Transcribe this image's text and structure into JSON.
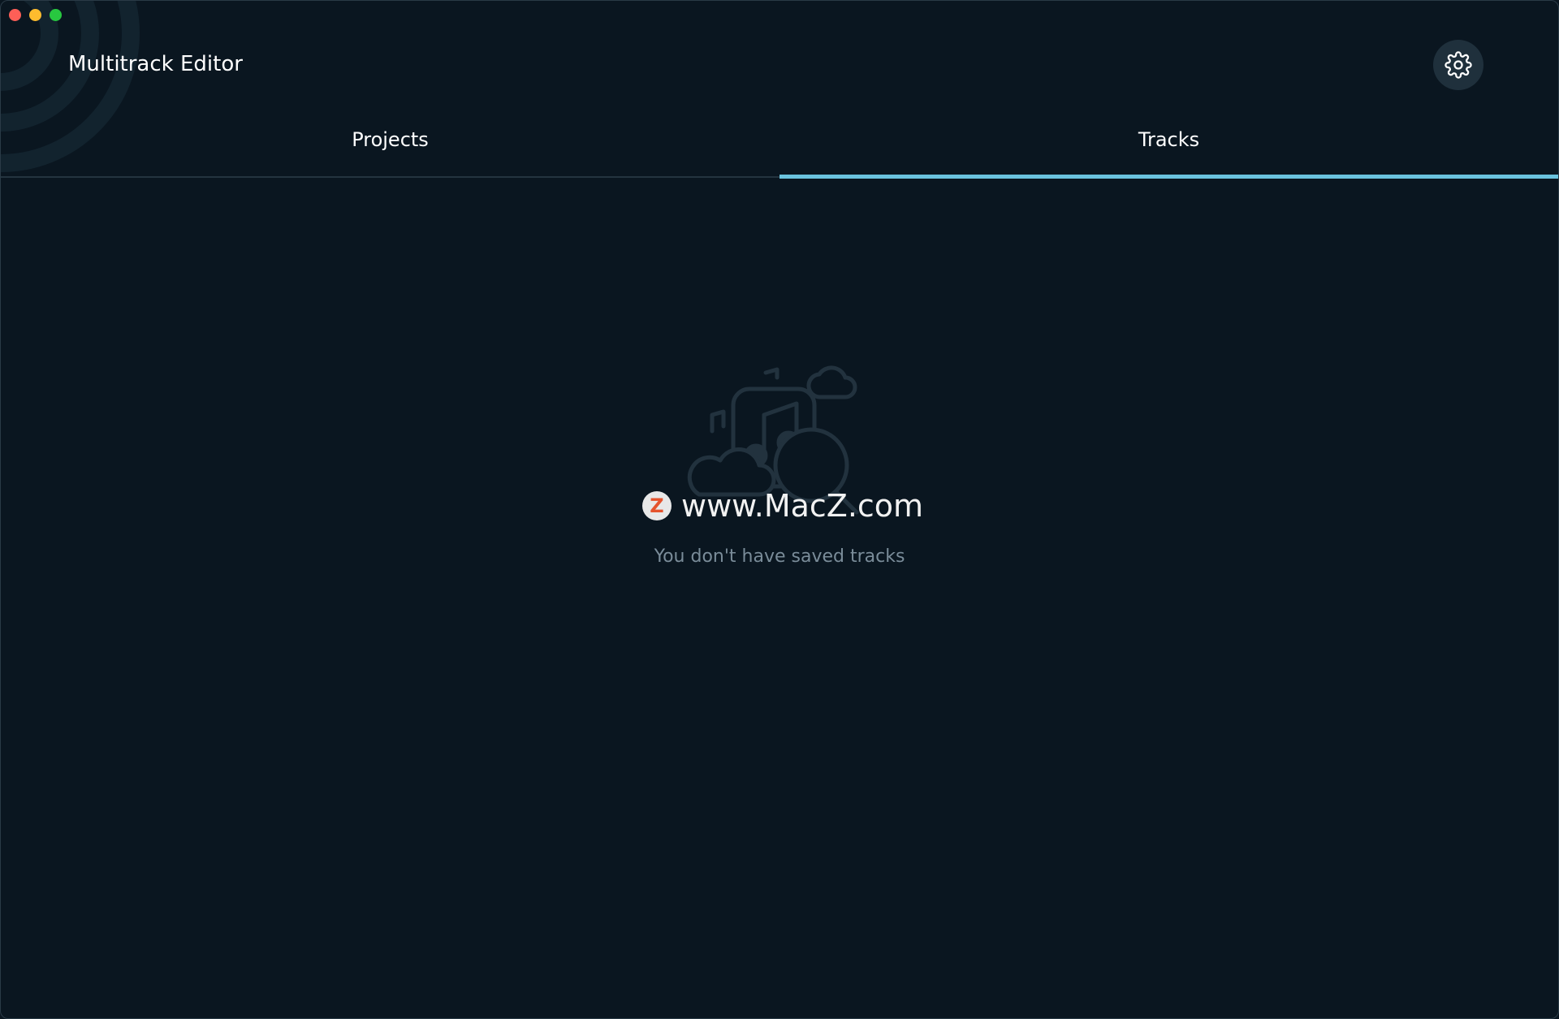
{
  "window": {
    "controls": [
      "close",
      "minimize",
      "maximize"
    ]
  },
  "header": {
    "title": "Multitrack Editor",
    "settings_icon": "gear-icon"
  },
  "tabs": [
    {
      "label": "Projects",
      "active": false
    },
    {
      "label": "Tracks",
      "active": true
    }
  ],
  "main": {
    "illustration_icon": "music-search-icon",
    "watermark": "www.MacZ.com",
    "watermark_badge": "Z",
    "empty_message": "You don't have saved tracks"
  },
  "colors": {
    "background": "#0a1620",
    "accent": "#6ac3de",
    "muted_text": "#7a8c99",
    "settings_bg": "#1f303c"
  }
}
